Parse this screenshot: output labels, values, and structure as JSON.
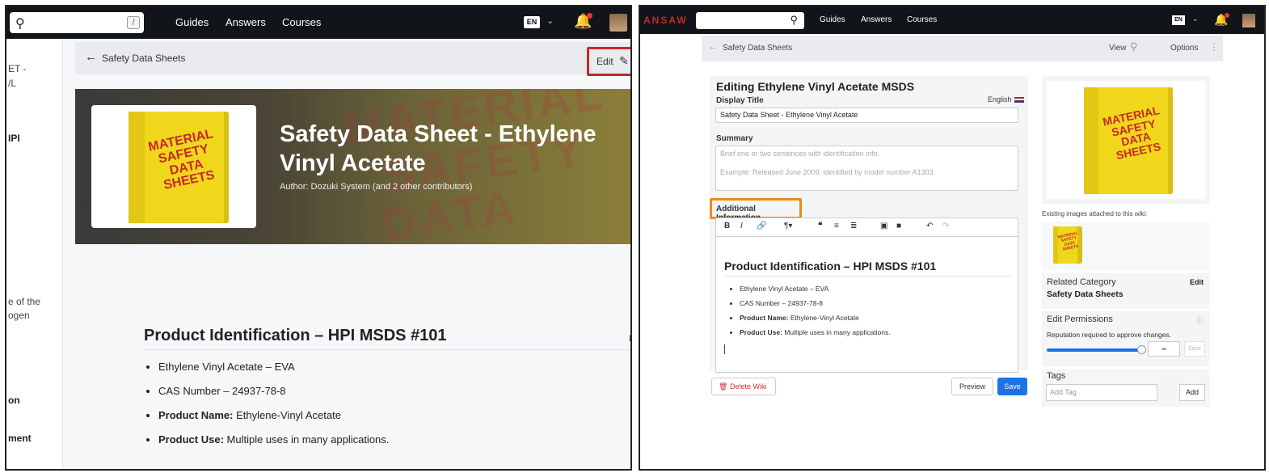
{
  "left": {
    "search": {
      "shortcut": "/"
    },
    "nav": [
      "Guides",
      "Answers",
      "Courses"
    ],
    "lang": "EN",
    "sidebar": [
      "ET -",
      "/L",
      "IPI",
      "e of the",
      "ogen",
      "on",
      "ment"
    ],
    "breadcrumb": "Safety Data Sheets",
    "edit_label": "Edit",
    "hero": {
      "binder_text": [
        "MATERIAL",
        "SAFETY",
        "DATA",
        "SHEETS"
      ],
      "watermark": [
        "MATERIAL",
        "SAFETY",
        "DATA"
      ],
      "title": "Safety Data Sheet - Ethylene Vinyl Acetate",
      "author": "Author: Dozuki System (and 2 other contributors)"
    },
    "section_title": "Product Identification – HPI MSDS #101",
    "edge_letter": "E",
    "list": [
      {
        "bold": "",
        "text": "Ethylene Vinyl Acetate – EVA"
      },
      {
        "bold": "",
        "text": "CAS Number – 24937-78-8"
      },
      {
        "bold": "Product Name:",
        "text": " Ethylene-Vinyl Acetate"
      },
      {
        "bold": "Product Use:",
        "text": " Multiple uses in many applications."
      }
    ]
  },
  "right": {
    "brand": "ANSAW",
    "nav": [
      "Guides",
      "Answers",
      "Courses"
    ],
    "lang": "EN",
    "breadcrumb": "Safety Data Sheets",
    "view_label": "View",
    "options_label": "Options",
    "form": {
      "title": "Editing Ethylene Vinyl Acetate MSDS",
      "display_title_label": "Display Title",
      "language": "English",
      "display_title_value": "Safety Data Sheet - Ethylene Vinyl Acetate",
      "summary_label": "Summary",
      "summary_placeholder_1": "Brief one or two sentences with identification info.",
      "summary_placeholder_2": "Example: Released June 2009, identified by model number A1303.",
      "additional_info_label": "Additional Information",
      "editor_heading": "Product Identification – HPI MSDS #101",
      "editor_list": [
        {
          "bold": "",
          "text": "Ethylene Vinyl Acetate – EVA"
        },
        {
          "bold": "",
          "text": "CAS Number – 24937-78-8"
        },
        {
          "bold": "Product Name:",
          "text": " Ethylene-Vinyl Acetate"
        },
        {
          "bold": "Product Use:",
          "text": " Multiple uses in many applications."
        }
      ]
    },
    "buttons": {
      "delete": "Delete Wiki",
      "preview": "Preview",
      "save": "Save"
    },
    "sidebar": {
      "binder_text": [
        "MATERIAL",
        "SAFETY",
        "DATA",
        "SHEETS"
      ],
      "existing_images_label": "Existing images attached to this wiki:",
      "related_category_label": "Related Category",
      "related_category_value": "Safety Data Sheets",
      "related_edit": "Edit",
      "permissions_label": "Edit Permissions",
      "permissions_desc": "Reputation required to approve changes.",
      "permissions_value": "∞",
      "permissions_save": "Save",
      "tags_label": "Tags",
      "tag_placeholder": "Add Tag",
      "tag_add": "Add"
    }
  }
}
